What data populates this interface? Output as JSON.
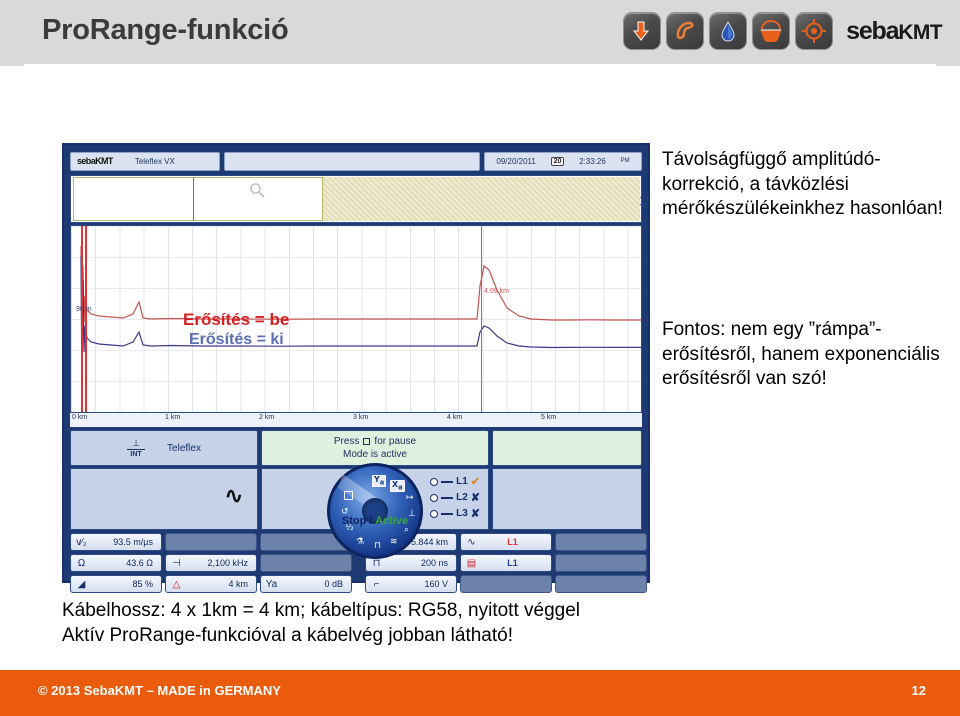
{
  "header": {
    "title": "ProRange-funkció",
    "brand": "seba",
    "brand_suffix": "KMT",
    "icons": [
      {
        "name": "down-arrow-icon",
        "glyph": "⬇"
      },
      {
        "name": "phone-handset-icon",
        "glyph": "✆"
      },
      {
        "name": "water-drop-icon",
        "glyph": "💧"
      },
      {
        "name": "basket-icon",
        "glyph": "◠"
      },
      {
        "name": "target-crosshair-icon",
        "glyph": "◎"
      }
    ]
  },
  "device": {
    "brand": "seba",
    "brand_suffix": "KMT",
    "model": "Teleflex VX",
    "date": "09/20/2011",
    "calendar_day": "20",
    "time": "2:33:26",
    "ampm": "PM",
    "graph": {
      "gain_on_label": "Erősítés = be",
      "gain_off_label": "Erősítés = ki",
      "near_marker": "90 m",
      "cursor_label": "4.09 km",
      "x_ticks": [
        "0 km",
        "1 km",
        "2 km",
        "3 km",
        "4 km",
        "5 km"
      ]
    },
    "mode": {
      "int_label": "INT",
      "method": "Teleflex",
      "press_line": "Press",
      "press_line_tail": "for pause",
      "mode_line": "Mode is active"
    },
    "legend": [
      {
        "label": "L1",
        "state": "✔",
        "ok": true
      },
      {
        "label": "L2",
        "state": "✘",
        "ok": false
      },
      {
        "label": "L3",
        "state": "✘",
        "ok": false
      }
    ],
    "dial_icons": [
      "Ya",
      "Xa",
      "⇥",
      "⌁",
      "🔍",
      "≋",
      "⊐",
      "⚖",
      "½",
      "↺",
      "▢"
    ],
    "run_state_stop": "Stop /",
    "run_state_active": "Active",
    "values": {
      "col1": [
        {
          "icon": "velocity-icon",
          "glyph": "v⁄₂",
          "value": "93.5 m/µs"
        },
        {
          "icon": "impedance-icon",
          "glyph": "Ω",
          "value": "43.6 Ω"
        },
        {
          "icon": "gain-ramp-icon",
          "glyph": "◢",
          "value": "85 %"
        }
      ],
      "col2": [
        {
          "icon": "blank-slot",
          "glyph": "",
          "value": ""
        },
        {
          "icon": "frequency-icon",
          "glyph": "⊣",
          "value": "2,100 kHz"
        },
        {
          "icon": "range-icon",
          "glyph": "△",
          "value": "4 km"
        }
      ],
      "col3": [
        {
          "icon": "blank-slot",
          "glyph": "",
          "value": ""
        },
        {
          "icon": "blank-slot",
          "glyph": "",
          "value": ""
        },
        {
          "icon": "y-gain-icon",
          "glyph": "Ya",
          "value": "0 dB"
        }
      ],
      "col4": [
        {
          "icon": "x-cursor-icon",
          "glyph": "Xa",
          "value": "5.844 km"
        },
        {
          "icon": "pulse-width-icon",
          "glyph": "⊓",
          "value": "200 ns"
        },
        {
          "icon": "pulse-voltage-icon",
          "glyph": "⌐",
          "value": "160 V"
        }
      ],
      "col5": [
        {
          "icon": "trace-curve-icon",
          "glyph": "∿",
          "value": "L1",
          "color": "red"
        },
        {
          "icon": "memory-icon",
          "glyph": "▤",
          "value": "L1",
          "color": "blue"
        },
        {
          "icon": "blank-slot",
          "glyph": "",
          "value": ""
        }
      ],
      "col6": [
        {
          "icon": "blank-slot",
          "glyph": "",
          "value": ""
        },
        {
          "icon": "blank-slot",
          "glyph": "",
          "value": ""
        },
        {
          "icon": "blank-slot",
          "glyph": "",
          "value": ""
        }
      ]
    }
  },
  "right_text": {
    "paragraph1": "Távolságfüggő amplitúdó-korrekció, a távközlési mérőkészülékeinkhez hasonlóan!",
    "paragraph2": "Fontos: nem egy ”rámpa”-erősítésről, hanem exponenciális erősítésről van szó!"
  },
  "bottom_text": {
    "line1": "Kábelhossz: 4 x 1km = 4 km; kábeltípus: RG58, nyitott véggel",
    "line2": "Aktív ProRange-funkcióval a kábelvég jobban látható!"
  },
  "footer": {
    "copyright": "© 2013 SebaKMT – MADE in GERMANY",
    "page": "12"
  },
  "colors": {
    "accent_orange": "#ea5b0c",
    "header_gray": "#d9d9d9",
    "trace_red": "#c2544f",
    "trace_blue": "#3a3a8c",
    "device_blue": "#1d3a73"
  }
}
